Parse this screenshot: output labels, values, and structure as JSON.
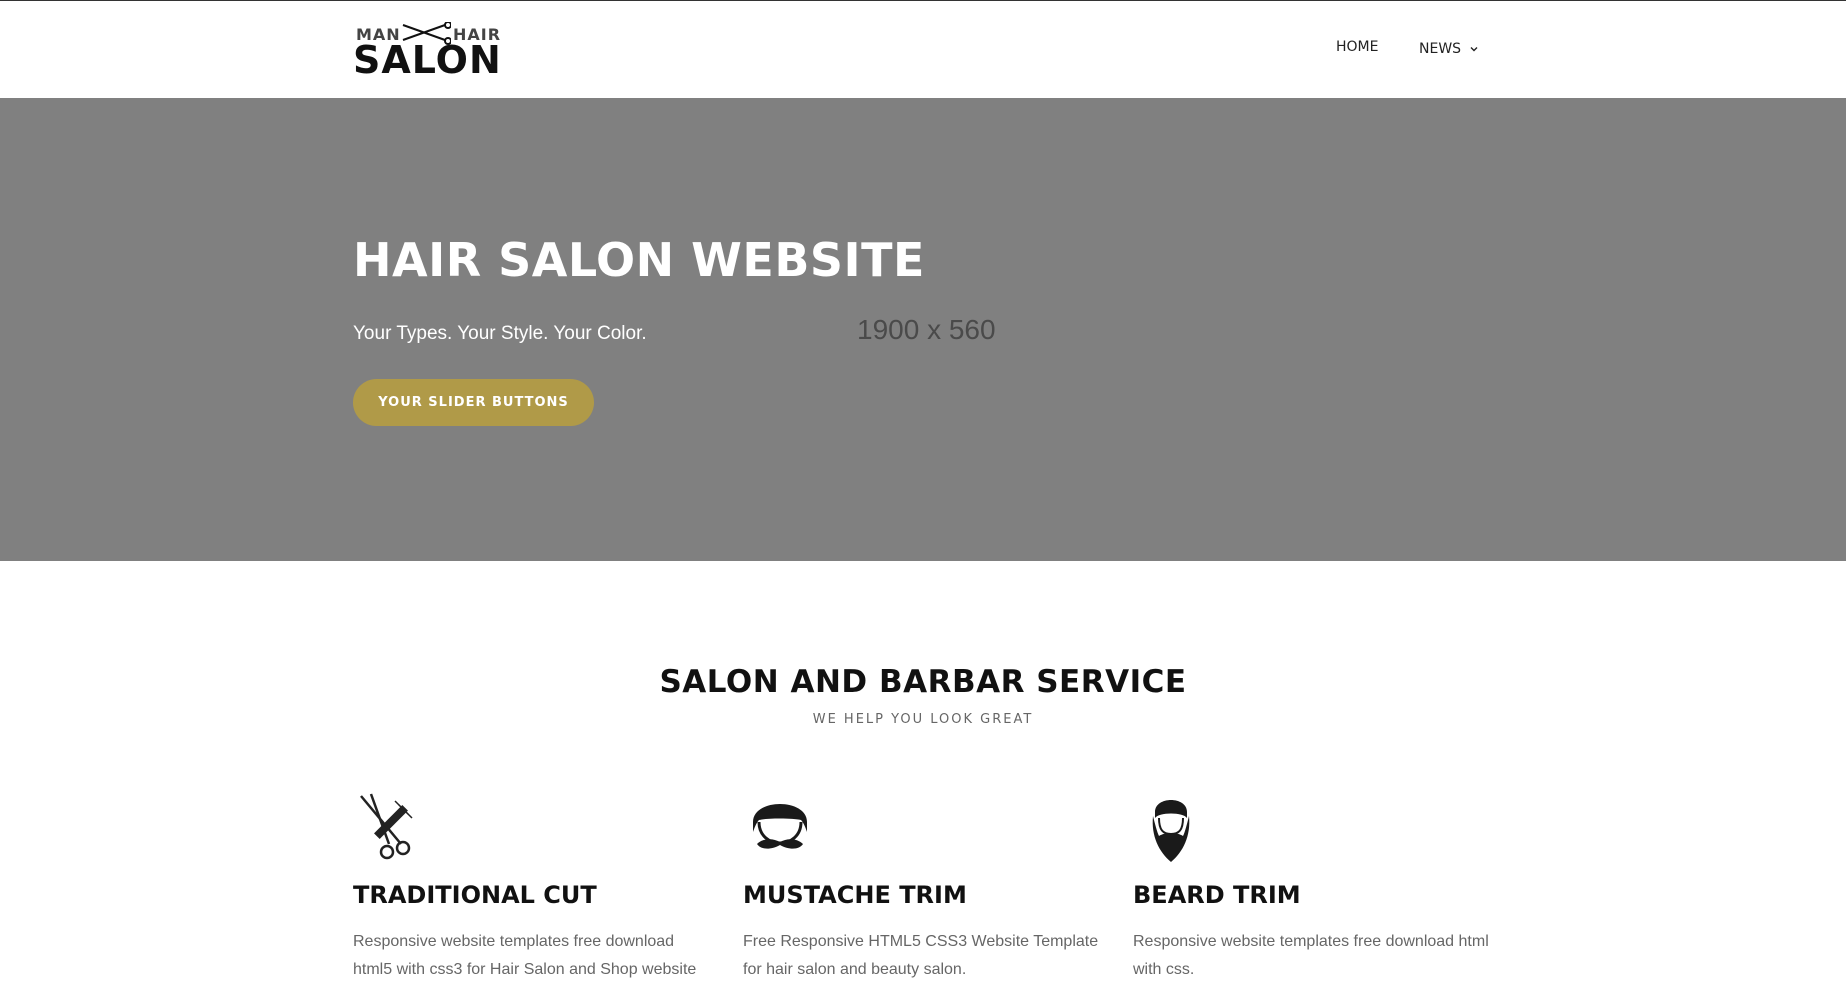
{
  "brand": {
    "logo_top_left": "MAN",
    "logo_top_right": "HAIR",
    "logo_main": "SALON"
  },
  "nav": {
    "home": "HOME",
    "news": "NEWS"
  },
  "hero": {
    "title": "HAIR SALON WEBSITE",
    "subtitle": "Your Types. Your Style. Your Color.",
    "placeholder_dimensions": "1900 x 560",
    "button": "YOUR SLIDER BUTTONS",
    "background_color": "#808080",
    "button_color": "#b09a48"
  },
  "services": {
    "title": "SALON AND BARBAR SERVICE",
    "subtitle": "WE HELP YOU LOOK GREAT",
    "items": [
      {
        "icon": "scissors-comb-icon",
        "name": "TRADITIONAL CUT",
        "description": "Responsive website templates free download html5 with css3 for Hair Salon and Shop website"
      },
      {
        "icon": "mustache-face-icon",
        "name": "MUSTACHE TRIM",
        "description": "Free Responsive HTML5 CSS3 Website Template for hair salon and beauty salon."
      },
      {
        "icon": "beard-face-icon",
        "name": "BEARD TRIM",
        "description": "Responsive website templates free download html with css."
      }
    ]
  }
}
